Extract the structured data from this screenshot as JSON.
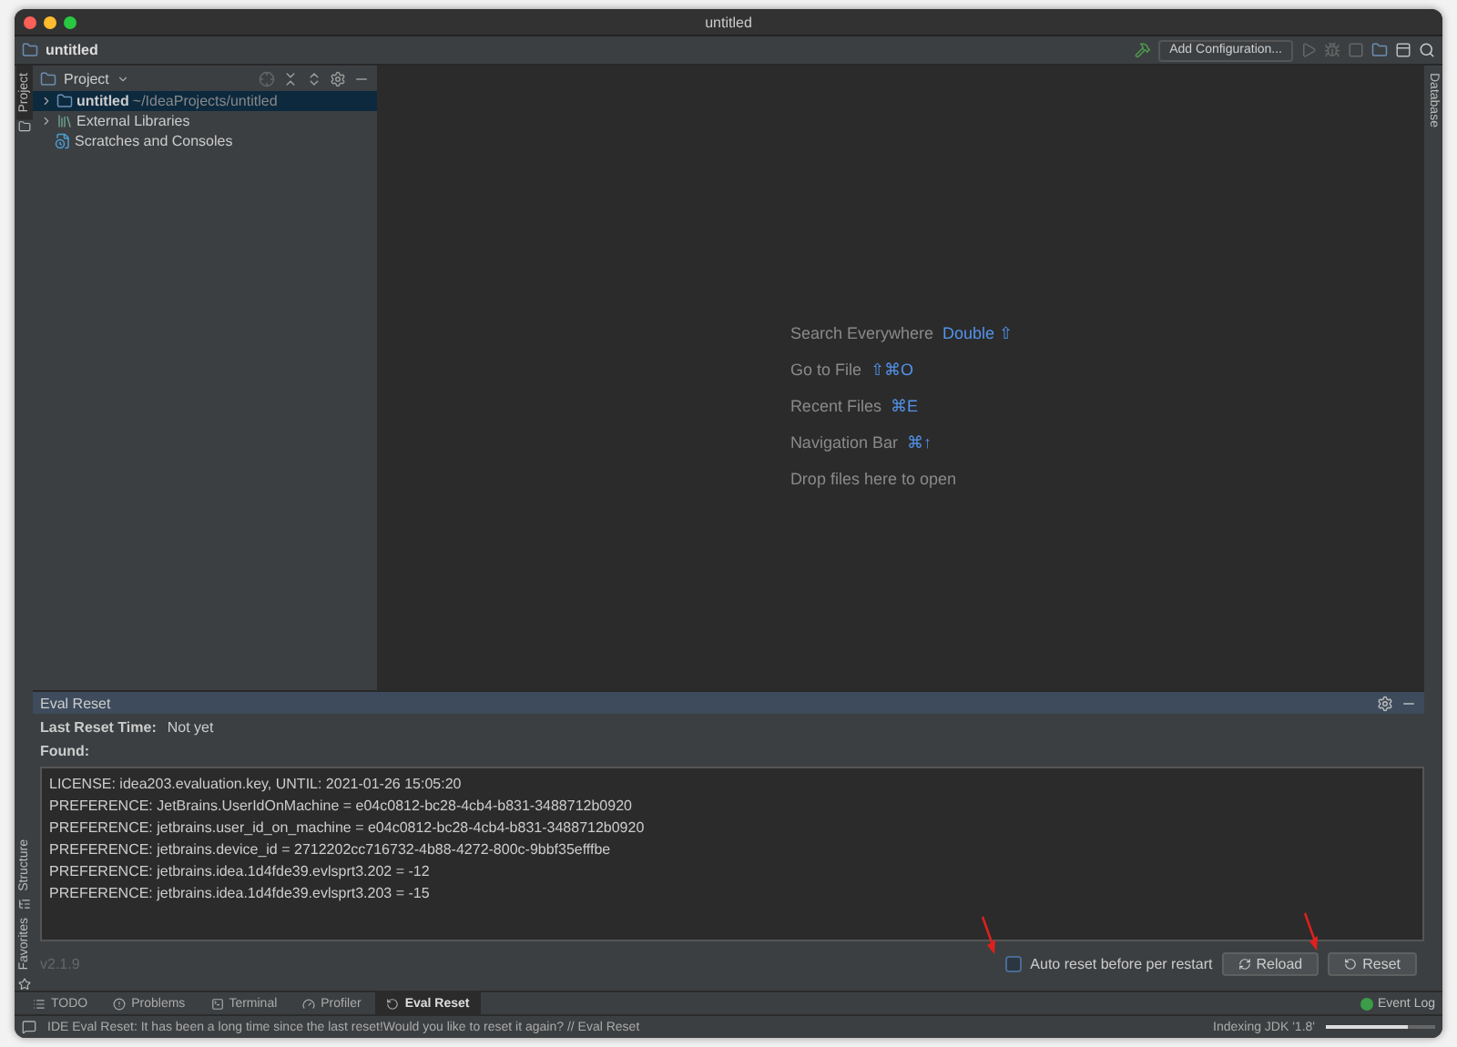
{
  "window": {
    "title": "untitled"
  },
  "navbar": {
    "project": "untitled",
    "run_config": "Add Configuration..."
  },
  "left_strip": {
    "top": [
      {
        "label": "Project",
        "selected": true
      }
    ],
    "bottom": [
      {
        "label": "Structure",
        "kind": "structure"
      },
      {
        "label": "Favorites",
        "kind": "favorites"
      }
    ]
  },
  "right_strip": [
    {
      "label": "Database"
    }
  ],
  "project_panel": {
    "title": "Project",
    "tree": [
      {
        "label": "untitled",
        "path": "~/IdeaProjects/untitled",
        "selected": true,
        "expanded": false,
        "kind": "module"
      },
      {
        "label": "External Libraries",
        "selected": false,
        "expanded": false,
        "kind": "library"
      },
      {
        "label": "Scratches and Consoles",
        "selected": false,
        "kind": "scratch"
      }
    ]
  },
  "editor": {
    "hints": [
      {
        "label": "Search Everywhere",
        "shortcut": "Double ⇧"
      },
      {
        "label": "Go to File",
        "shortcut": "⇧⌘O"
      },
      {
        "label": "Recent Files",
        "shortcut": "⌘E"
      },
      {
        "label": "Navigation Bar",
        "shortcut": "⌘↑"
      }
    ],
    "drop_text": "Drop files here to open"
  },
  "eval_panel": {
    "title": "Eval Reset",
    "last_reset_label": "Last Reset Time:",
    "last_reset_value": "Not yet",
    "found_label": "Found:",
    "lines": [
      "LICENSE: idea203.evaluation.key, UNTIL: 2021-01-26 15:05:20",
      "PREFERENCE: JetBrains.UserIdOnMachine = e04c0812-bc28-4cb4-b831-3488712b0920",
      "PREFERENCE: jetbrains.user_id_on_machine = e04c0812-bc28-4cb4-b831-3488712b0920",
      "PREFERENCE: jetbrains.device_id = 2712202cc716732-4b88-4272-800c-9bbf35efffbe",
      "PREFERENCE: jetbrains.idea.1d4fde39.evlsprt3.202 = -12",
      "PREFERENCE: jetbrains.idea.1d4fde39.evlsprt3.203 = -15"
    ],
    "version": "v2.1.9",
    "auto_reset": {
      "label": "Auto reset before per restart",
      "checked": false
    },
    "buttons": [
      {
        "label": "Reload",
        "kind": "reload"
      },
      {
        "label": "Reset",
        "kind": "reset"
      }
    ]
  },
  "tool_tabs": [
    {
      "label": "TODO",
      "kind": "todo",
      "selected": false
    },
    {
      "label": "Problems",
      "kind": "problems",
      "selected": false
    },
    {
      "label": "Terminal",
      "kind": "terminal",
      "selected": false
    },
    {
      "label": "Profiler",
      "kind": "profiler",
      "selected": false
    },
    {
      "label": "Eval Reset",
      "kind": "reset",
      "selected": true
    }
  ],
  "event_log": "Event Log",
  "status_bar": {
    "message": "IDE Eval Reset: It has been a long time since the last reset!Would you like to reset it again? // Eval Reset",
    "indexing": {
      "label": "Indexing JDK '1.8'",
      "level": 0.75
    }
  }
}
